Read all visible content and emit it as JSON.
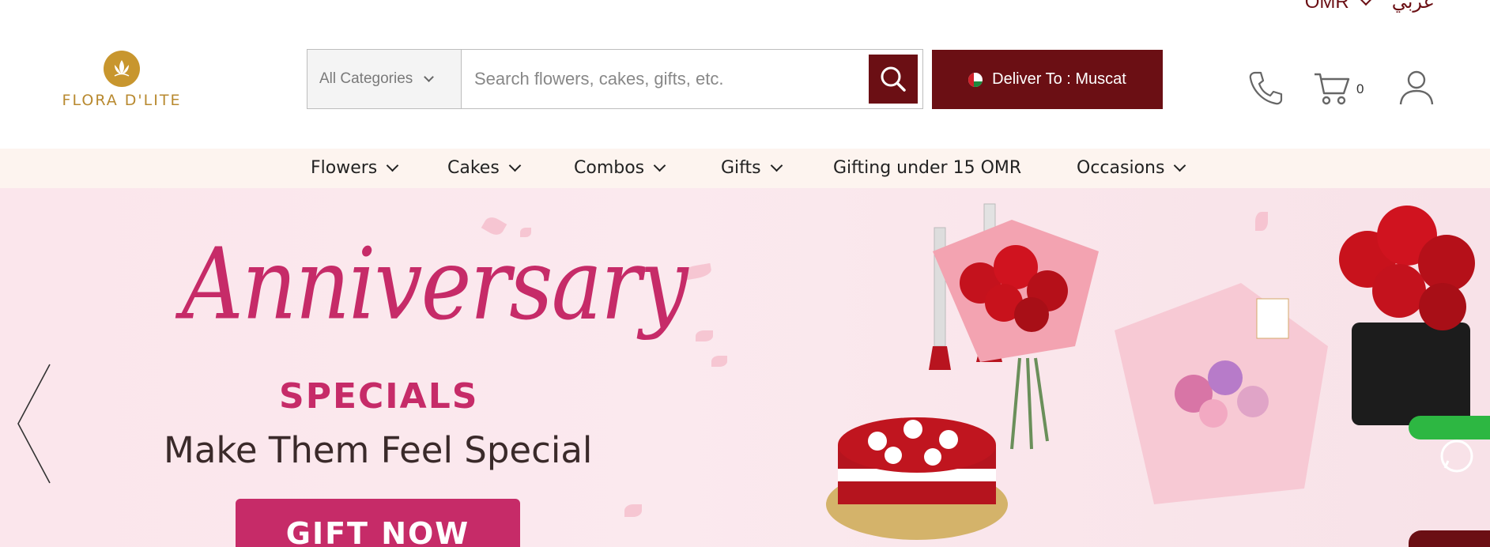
{
  "topbar": {
    "currency": "OMR",
    "language": "عربي"
  },
  "brand": {
    "name": "FLORA D'LITE"
  },
  "search": {
    "category": "All Categories",
    "placeholder": "Search flowers, cakes, gifts, etc."
  },
  "deliver": {
    "label": "Deliver To : Muscat"
  },
  "cart": {
    "count": "0"
  },
  "nav": [
    {
      "label": "Flowers"
    },
    {
      "label": "Cakes"
    },
    {
      "label": "Combos"
    },
    {
      "label": "Gifts"
    },
    {
      "label": "Gifting under 15 OMR"
    },
    {
      "label": "Occasions"
    }
  ],
  "hero": {
    "script_title": "Anniversary",
    "subtitle": "SPECIALS",
    "tagline": "Make Them Feel Special",
    "cta": "GIFT NOW"
  },
  "colors": {
    "brand": "#6b0f14",
    "accent": "#c62b68",
    "gold": "#b8892f",
    "nav_bg": "#fdf4ef",
    "whatsapp": "#2db742"
  }
}
